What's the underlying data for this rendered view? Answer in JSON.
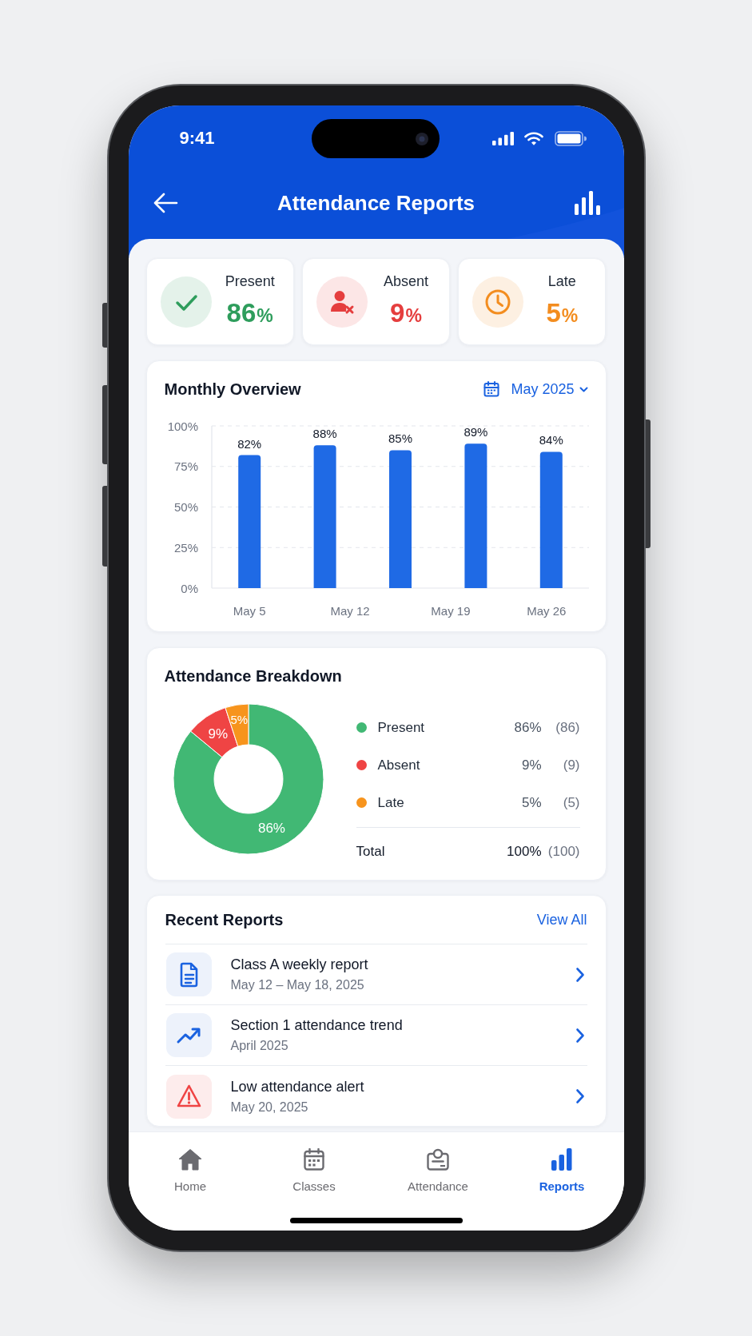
{
  "status_bar": {
    "time": "9:41"
  },
  "header": {
    "title": "Attendance Reports"
  },
  "stats": [
    {
      "kind": "present",
      "label": "Present",
      "value": "86",
      "unit": "%",
      "color": "#2e9d5c"
    },
    {
      "kind": "absent",
      "label": "Absent",
      "value": "9",
      "unit": "%",
      "color": "#e53e3e"
    },
    {
      "kind": "late",
      "label": "Late",
      "value": "5",
      "unit": "%",
      "color": "#f38d1f"
    }
  ],
  "monthly_overview": {
    "title": "Monthly Overview",
    "period": "May 2025",
    "chart_data": {
      "type": "bar",
      "categories": [
        "May 5",
        "May 12",
        null,
        "May 19",
        "May 26"
      ],
      "values": [
        82,
        88,
        85,
        89,
        84
      ],
      "value_labels": [
        "82%",
        "88%",
        "85%",
        "89%",
        "84%"
      ],
      "grid": true,
      "ylim": [
        0,
        100
      ],
      "yticks": [
        {
          "value": 0,
          "label": "0%"
        },
        {
          "value": 25,
          "label": "25%"
        },
        {
          "value": 50,
          "label": "50%"
        },
        {
          "value": 75,
          "label": "75%"
        },
        {
          "value": 100,
          "label": "100%"
        }
      ]
    }
  },
  "breakdown": {
    "title": "Attendance Breakdown",
    "chart_data": {
      "type": "donut",
      "values": [
        86,
        9,
        5
      ],
      "value_labels": [
        "86%",
        "9%",
        "5%"
      ]
    },
    "legend": [
      {
        "label": "Present",
        "color": "#41b874",
        "percent": "86%",
        "count": "(86)"
      },
      {
        "label": "Absent",
        "color": "#ef4444",
        "percent": "9%",
        "count": "(9)"
      },
      {
        "label": "Late",
        "color": "#f7941d",
        "percent": "5%",
        "count": "(5)"
      }
    ],
    "total": {
      "label": "Total",
      "percent": "100%",
      "count": "(100)"
    }
  },
  "recent_reports": {
    "title": "Recent Reports",
    "action": "View All",
    "items": [
      {
        "kind": "document",
        "title": "Class A weekly report",
        "subtitle": "May 12 – May 18, 2025"
      },
      {
        "kind": "trend",
        "title": "Section 1 attendance trend",
        "subtitle": "April 2025"
      },
      {
        "kind": "alert",
        "title": "Low attendance alert",
        "subtitle": "May 20, 2025"
      }
    ]
  },
  "tab_bar": [
    {
      "kind": "home",
      "label": "Home",
      "selected": false
    },
    {
      "kind": "classes",
      "label": "Classes",
      "selected": false
    },
    {
      "kind": "attendance",
      "label": "Attendance",
      "selected": false
    },
    {
      "kind": "reports",
      "label": "Reports",
      "selected": true
    }
  ]
}
